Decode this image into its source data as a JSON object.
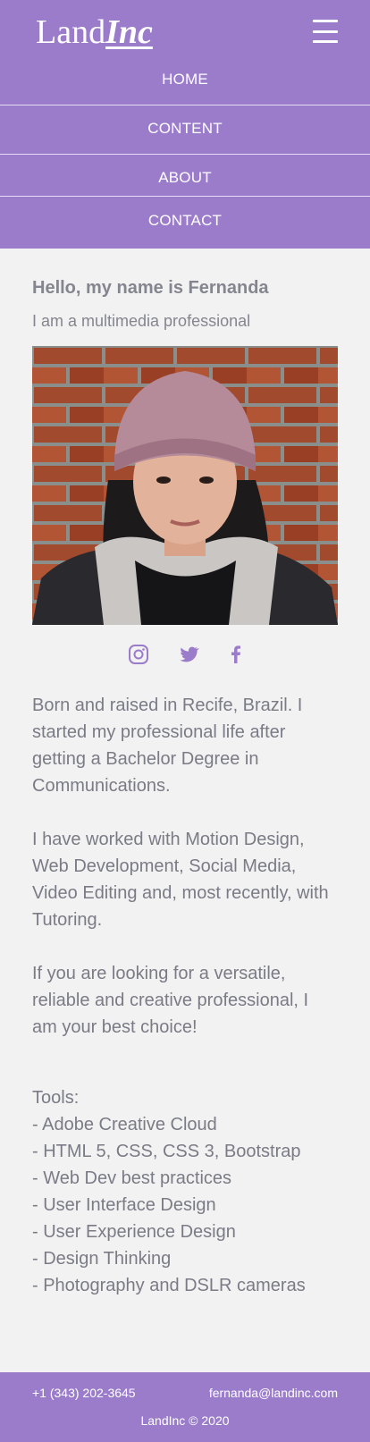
{
  "header": {
    "logo_land": "Land",
    "logo_inc": "Inc",
    "menu_icon": "hamburger-menu-icon"
  },
  "nav": {
    "items": [
      {
        "label": "HOME"
      },
      {
        "label": "CONTENT"
      },
      {
        "label": "ABOUT"
      },
      {
        "label": "CONTACT"
      }
    ]
  },
  "intro": {
    "greeting": "Hello, my name is Fernanda",
    "subtitle": "I am a multimedia professional"
  },
  "social": {
    "icons": [
      "instagram-icon",
      "twitter-icon",
      "facebook-icon"
    ]
  },
  "bio": {
    "p1": "Born and raised in Recife, Brazil. I started my professional life after getting a Bachelor Degree in Communications.",
    "p2": "I have worked with Motion Design, Web Development, Social Media, Video Editing and, most recently, with Tutoring.",
    "p3": "If you are looking for a versatile, reliable and creative professional, I am your best choice!"
  },
  "tools": {
    "title": "Tools:",
    "items": [
      "- Adobe Creative Cloud",
      "- HTML 5, CSS, CSS 3, Bootstrap",
      "- Web Dev best practices",
      "- User Interface Design",
      "- User Experience Design",
      "- Design Thinking",
      "- Photography and DSLR cameras"
    ]
  },
  "footer": {
    "phone": "+1 (343) 202-3645",
    "email": "fernanda@landinc.com",
    "copyright": "LandInc © 2020"
  },
  "colors": {
    "brand_purple": "#9b7ccb",
    "background": "#f2f2f2",
    "text_gray": "#7b7b86"
  }
}
